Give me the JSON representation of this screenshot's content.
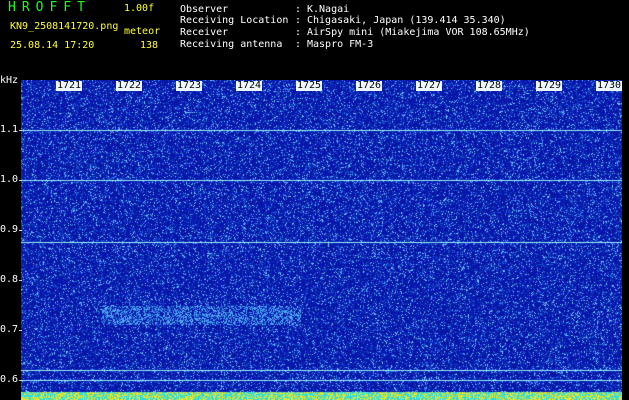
{
  "header": {
    "app_title": "HROFFT",
    "version": "1.00f",
    "file_name": "KN9_2508141720.png",
    "mode": "meteor",
    "datetime": "25.08.14 17:20",
    "count": "138"
  },
  "info": [
    {
      "label": "Observer",
      "value": "K.Nagai"
    },
    {
      "label": "Receiving Location",
      "value": "Chigasaki, Japan (139.414 35.340)"
    },
    {
      "label": "Receiver",
      "value": "AirSpy mini (Miakejima VOR 108.65MHz)"
    },
    {
      "label": "Receiving antenna",
      "value": "Maspro FM-3"
    }
  ],
  "info_separator": ":",
  "axis": {
    "y_unit": "kHz",
    "y_ticks": [
      "1.1",
      "1.0",
      "0.9",
      "0.8",
      "0.7",
      "0.6"
    ],
    "x_ticks": [
      "1721",
      "1722",
      "1723",
      "1724",
      "1725",
      "1726",
      "1727",
      "1728",
      "1729",
      "1730"
    ]
  },
  "colors": {
    "title": "#19ff19",
    "accent_text": "#ffff33",
    "background_noise": "#0a1fa8",
    "signal": "#7ff5ff"
  }
}
